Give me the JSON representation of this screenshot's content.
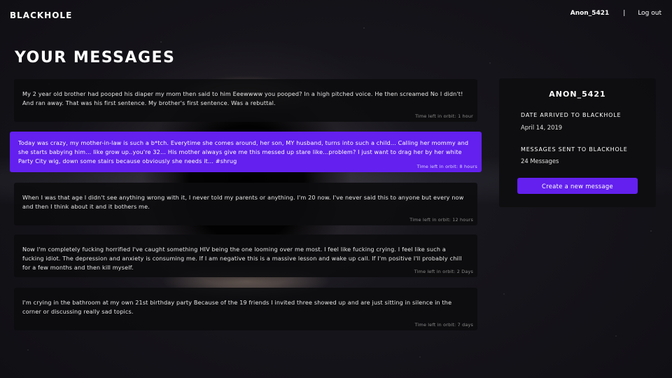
{
  "header": {
    "brand": "BLACKHOLE",
    "username": "Anon_5421",
    "separator": "|",
    "logout_label": "Log out"
  },
  "page_title": "YOUR MESSAGES",
  "messages": [
    {
      "text": "My 2 year old brother had pooped his diaper my mom then said to him Eeewwww you pooped? In a high pitched voice. He then screamed No I didn't! And ran away. That was his first sentence. My brother's first sentence. Was a rebuttal.",
      "time": "Time left in orbit: 1 hour"
    },
    {
      "text": "Today was crazy, my mother-in-law is such a b*tch. Everytime she comes around, her son, MY husband, turns into such a child... Calling her mommy and she starts babying him... like grow up..you're 32... His mother always give me this messed up stare like...problem? I just want to drag her by her white Party City wig, down some stairs because obviously she needs it... #shrug",
      "time": "Time left in orbit: 8 hours"
    },
    {
      "text": "When I was that age I didn't see anything wrong with it, I never told my parents or anything. I'm 20 now. I've never said this to anyone but every now and then I think about it and it bothers me.",
      "time": "Time left in orbit: 12 hours"
    },
    {
      "text": "Now I'm completely fucking horrified I've caught something HIV being the one looming over me most. I feel like fucking crying. I feel like such a fucking idiot. The depression and anxiety is consuming me. If I am negative this is a massive lesson and wake up call. If I'm positive I'll probably chill for a few months and then kill myself.",
      "time": "Time left in orbit: 2 Days"
    },
    {
      "text": "I'm crying in the bathroom at my own 21st birthday party Because of the 19 friends I invited three showed up and are just sitting in silence in the corner or discussing really sad topics.",
      "time": "Time left in orbit: 7 days"
    }
  ],
  "profile": {
    "name": "ANON_5421",
    "arrived_label": "DATE ARRIVED TO BLACKHOLE",
    "arrived_value": "April 14, 2019",
    "sent_label": "MESSAGES SENT TO BLACKHOLE",
    "sent_value": "24 Messages",
    "create_button": "Create a new message"
  },
  "colors": {
    "accent": "#6320ee",
    "card_bg": "#0c0c0e",
    "text": "#ffffff"
  }
}
